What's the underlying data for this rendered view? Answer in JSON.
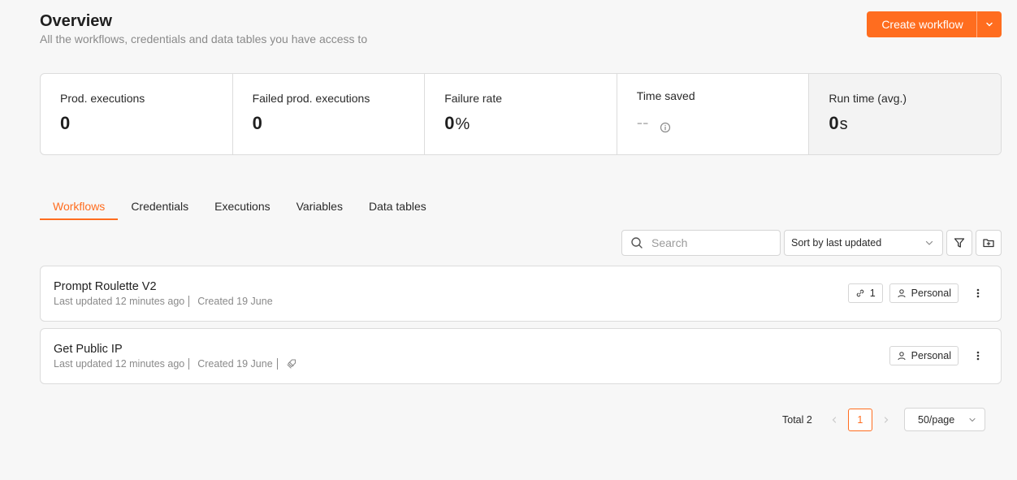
{
  "header": {
    "title": "Overview",
    "subtitle": "All the workflows, credentials and data tables you have access to",
    "create_button_label": "Create workflow"
  },
  "stats": [
    {
      "label": "Prod. executions",
      "value": "0",
      "unit": ""
    },
    {
      "label": "Failed prod. executions",
      "value": "0",
      "unit": ""
    },
    {
      "label": "Failure rate",
      "value": "0",
      "unit": "%"
    },
    {
      "label": "Time saved",
      "value": "--",
      "unit": ""
    },
    {
      "label": "Run time (avg.)",
      "value": "0",
      "unit": "s"
    }
  ],
  "tabs": [
    {
      "label": "Workflows",
      "active": true
    },
    {
      "label": "Credentials",
      "active": false
    },
    {
      "label": "Executions",
      "active": false
    },
    {
      "label": "Variables",
      "active": false
    },
    {
      "label": "Data tables",
      "active": false
    }
  ],
  "toolbar": {
    "search_placeholder": "Search",
    "search_value": "",
    "sort_value": "Sort by last updated"
  },
  "workflows": [
    {
      "name": "Prompt Roulette V2",
      "last_updated": "Last updated 12 minutes ago",
      "created": "Created 19 June",
      "link_count": "1",
      "owner": "Personal"
    },
    {
      "name": "Get Public IP",
      "last_updated": "Last updated 12 minutes ago",
      "created": "Created 19 June",
      "owner": "Personal"
    }
  ],
  "pagination": {
    "total_label": "Total 2",
    "current_page": "1",
    "per_page": "50/page"
  },
  "colors": {
    "accent": "#ff6d1f",
    "background": "#f7f7f7",
    "border": "#dcdcdc"
  }
}
